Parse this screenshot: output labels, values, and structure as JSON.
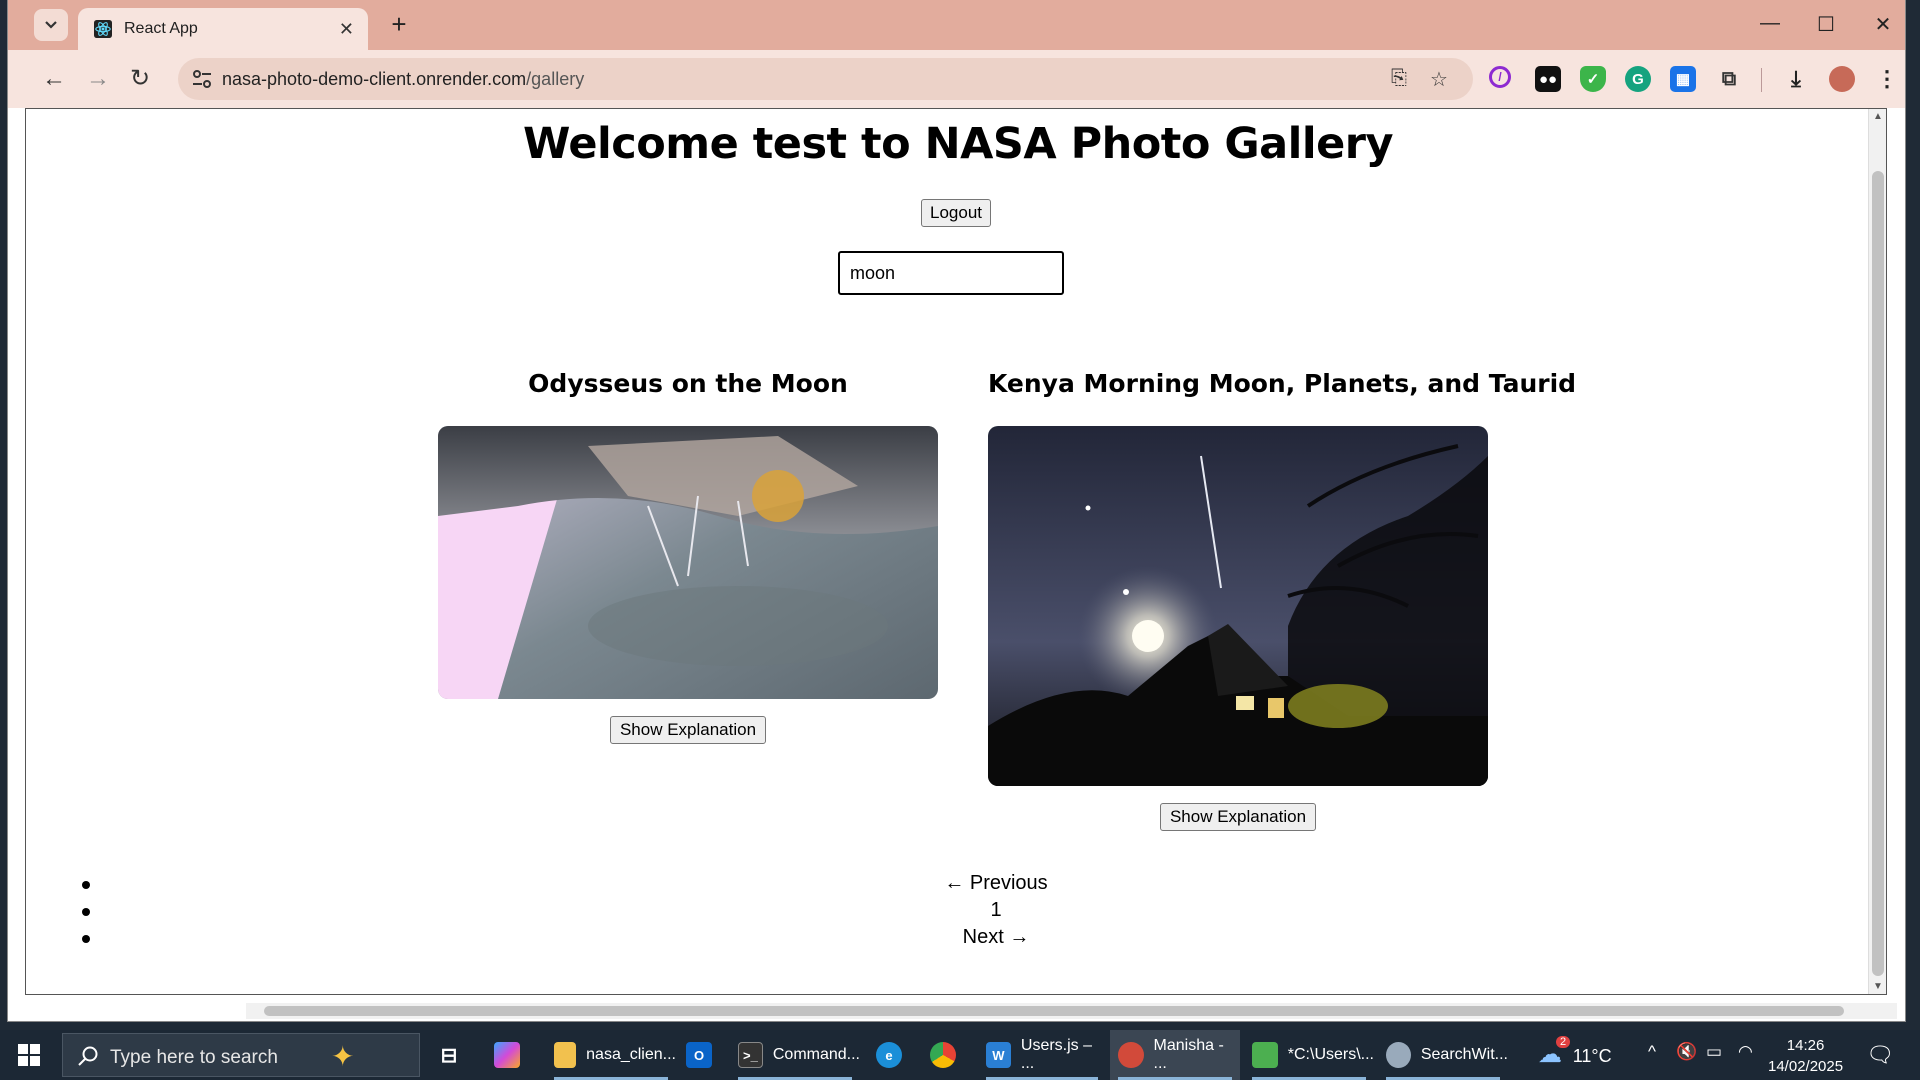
{
  "browser": {
    "tab_title": "React App",
    "url_host": "nasa-photo-demo-client.onrender.com",
    "url_path": "/gallery"
  },
  "page": {
    "title": "Welcome test to NASA Photo Gallery",
    "logout_label": "Logout",
    "search_value": "moon",
    "cards": [
      {
        "title": "Odysseus on the Moon",
        "button_label": "Show Explanation"
      },
      {
        "title": "Kenya Morning Moon, Planets, and Taurid",
        "button_label": "Show Explanation"
      }
    ],
    "pagination": [
      "← Previous",
      "1",
      "Next →"
    ]
  },
  "taskbar": {
    "search_placeholder": "Type here to search",
    "apps": [
      {
        "label": "nasa_clien...",
        "icon": "folder-icon",
        "color": "#f2c14e"
      },
      {
        "label": "",
        "icon": "outlook-icon",
        "color": "#0a64c8"
      },
      {
        "label": "Command...",
        "icon": "terminal-icon",
        "color": "#333333"
      },
      {
        "label": "",
        "icon": "edge-icon",
        "color": "#1b8fd8"
      },
      {
        "label": "",
        "icon": "chrome-icon",
        "color": "#e84335"
      },
      {
        "label": "Users.js – ...",
        "icon": "vscode-icon",
        "color": "#2a7fd4"
      },
      {
        "label": "Manisha - ...",
        "icon": "chrome-profile-icon",
        "color": "#d24a3a"
      },
      {
        "label": "*C:\\Users\\...",
        "icon": "notepad-icon",
        "color": "#4caf50"
      },
      {
        "label": "SearchWit...",
        "icon": "paint-icon",
        "color": "#9ab"
      }
    ],
    "weather": "11°C",
    "weather_badge": "2",
    "time": "14:26",
    "date": "14/02/2025"
  },
  "colors": {
    "tabstrip": "#e2ac9d",
    "toolbar": "#f7e4de",
    "taskbar": "#1c2835"
  }
}
